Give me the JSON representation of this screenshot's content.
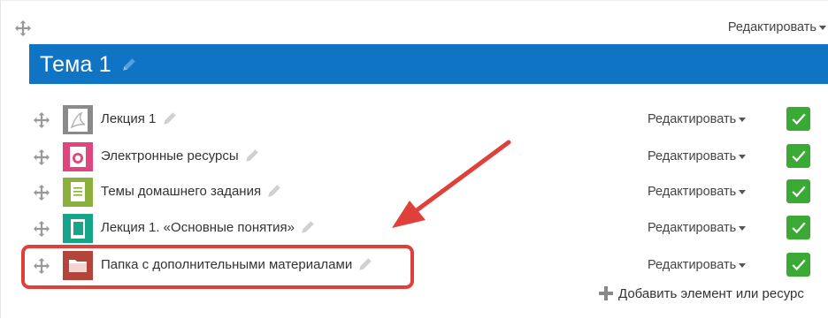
{
  "section": {
    "title": "Тема 1",
    "edit_label": "Редактировать"
  },
  "activities": [
    {
      "name": "Лекция 1",
      "edit_label": "Редактировать",
      "icon": "pdf-icon",
      "icon_color": "#8a8a8a"
    },
    {
      "name": "Электронные ресурсы",
      "edit_label": "Редактировать",
      "icon": "url-icon",
      "icon_color": "#e0457b"
    },
    {
      "name": "Темы домашнего задания",
      "edit_label": "Редактировать",
      "icon": "page-icon",
      "icon_color": "#8bb03b"
    },
    {
      "name": "Лекция 1. «Основные понятия»",
      "edit_label": "Редактировать",
      "icon": "book-icon",
      "icon_color": "#17a589"
    },
    {
      "name": "Папка с дополнительными материалами",
      "edit_label": "Редактировать",
      "icon": "folder-icon",
      "icon_color": "#b2443a"
    }
  ],
  "add_activity_label": "Добавить элемент или ресурс",
  "colors": {
    "banner": "#0f74c4",
    "check": "#3aaa35",
    "highlight": "#e0403a"
  }
}
